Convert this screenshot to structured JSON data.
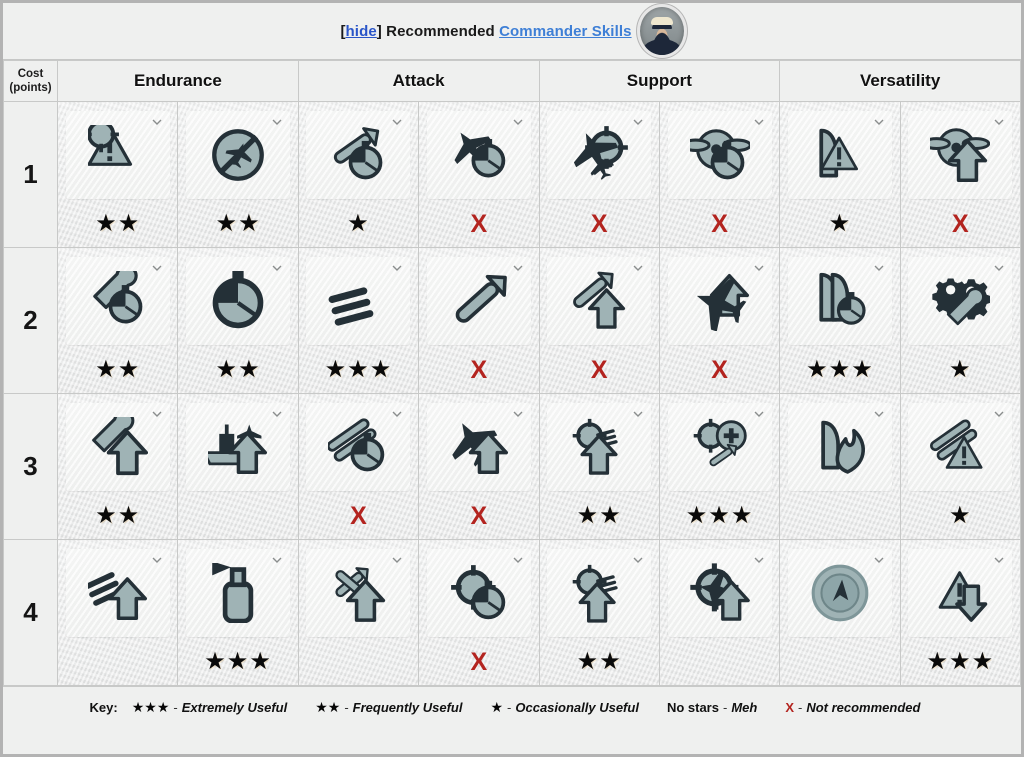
{
  "banner": {
    "hide_open": "[",
    "hide_label": "hide",
    "hide_close": "]",
    "title": " Recommended ",
    "link_label": "Commander Skills",
    "avatar_name": "commander-portrait"
  },
  "table": {
    "cost_header_line1": "Cost",
    "cost_header_line2": "(points)",
    "categories": [
      "Endurance",
      "Attack",
      "Support",
      "Versatility"
    ],
    "rows": [
      {
        "cost": "1",
        "cells": [
          {
            "icon": "priority-target-icon",
            "rating": "★★",
            "type": "stars"
          },
          {
            "icon": "no-aircraft-alert-icon",
            "rating": "★★",
            "type": "stars"
          },
          {
            "icon": "torpedo-armament-expertise-icon",
            "rating": "★",
            "type": "stars"
          },
          {
            "icon": "air-supremacy-timer-icon",
            "rating": "X",
            "type": "x"
          },
          {
            "icon": "bomber-flight-control-icon",
            "rating": "X",
            "type": "x"
          },
          {
            "icon": "engine-propeller-timer-icon",
            "rating": "X",
            "type": "x"
          },
          {
            "icon": "incoming-fire-alert-icon",
            "rating": "★",
            "type": "stars"
          },
          {
            "icon": "propeller-boost-icon",
            "rating": "X",
            "type": "x"
          }
        ]
      },
      {
        "cost": "2",
        "cells": [
          {
            "icon": "repair-timer-icon",
            "rating": "★★",
            "type": "stars"
          },
          {
            "icon": "stopwatch-icon",
            "rating": "★★",
            "type": "stars"
          },
          {
            "icon": "torpedo-spread-icon",
            "rating": "★★★",
            "type": "stars"
          },
          {
            "icon": "torpedo-boost-icon",
            "rating": "X",
            "type": "x"
          },
          {
            "icon": "smoke-boost-icon",
            "rating": "X",
            "type": "x"
          },
          {
            "icon": "aircraft-boost-icon",
            "rating": "X",
            "type": "x"
          },
          {
            "icon": "shell-timer-icon",
            "rating": "★★★",
            "type": "stars"
          },
          {
            "icon": "gears-wrench-icon",
            "rating": "★",
            "type": "stars"
          }
        ]
      },
      {
        "cost": "3",
        "cells": [
          {
            "icon": "wrench-boost-icon",
            "rating": "★★",
            "type": "stars"
          },
          {
            "icon": "ship-aircraft-boost-icon",
            "rating": "",
            "type": "none"
          },
          {
            "icon": "guns-timer-icon",
            "rating": "X",
            "type": "x"
          },
          {
            "icon": "aircraft-boost-2-icon",
            "rating": "X",
            "type": "x"
          },
          {
            "icon": "target-rockets-boost-icon",
            "rating": "★★",
            "type": "stars"
          },
          {
            "icon": "target-plus-medkit-icon",
            "rating": "★★★",
            "type": "stars"
          },
          {
            "icon": "fire-shell-icon",
            "rating": "",
            "type": "none"
          },
          {
            "icon": "guns-alert-icon",
            "rating": "★",
            "type": "stars"
          }
        ]
      },
      {
        "cost": "4",
        "cells": [
          {
            "icon": "rockets-boost-icon",
            "rating": "",
            "type": "none"
          },
          {
            "icon": "smoke-generator-icon",
            "rating": "★★★",
            "type": "stars"
          },
          {
            "icon": "torpedo-cross-boost-icon",
            "rating": "",
            "type": "none"
          },
          {
            "icon": "radar-timer-icon",
            "rating": "X",
            "type": "x"
          },
          {
            "icon": "target-rockets-boost-2-icon",
            "rating": "★★",
            "type": "stars"
          },
          {
            "icon": "target-aircraft-boost-icon",
            "rating": "",
            "type": "none"
          },
          {
            "icon": "radar-compass-icon",
            "rating": "",
            "type": "none"
          },
          {
            "icon": "alert-down-arrow-icon",
            "rating": "★★★",
            "type": "stars"
          }
        ]
      }
    ]
  },
  "key": {
    "label": "Key:",
    "items": [
      {
        "symbol": "★★★",
        "type": "stars",
        "dash": "-",
        "desc": "Extremely Useful"
      },
      {
        "symbol": "★★",
        "type": "stars",
        "dash": "-",
        "desc": "Frequently Useful"
      },
      {
        "symbol": "★",
        "type": "stars",
        "dash": "-",
        "desc": "Occasionally Useful"
      },
      {
        "symbol": "No stars",
        "type": "text",
        "dash": "-",
        "desc": "Meh"
      },
      {
        "symbol": "X",
        "type": "x",
        "dash": "-",
        "desc": "Not recommended"
      }
    ]
  },
  "colors": {
    "page_border": "#b3b3b3",
    "panel_bg": "#eff0ef",
    "grid_line": "#c8c9c8",
    "link_blue": "#3e7fd6",
    "hide_blue": "#2a55c8",
    "x_red": "#b3241f",
    "icon_dark": "#243037",
    "icon_light": "#8fa5a8"
  }
}
